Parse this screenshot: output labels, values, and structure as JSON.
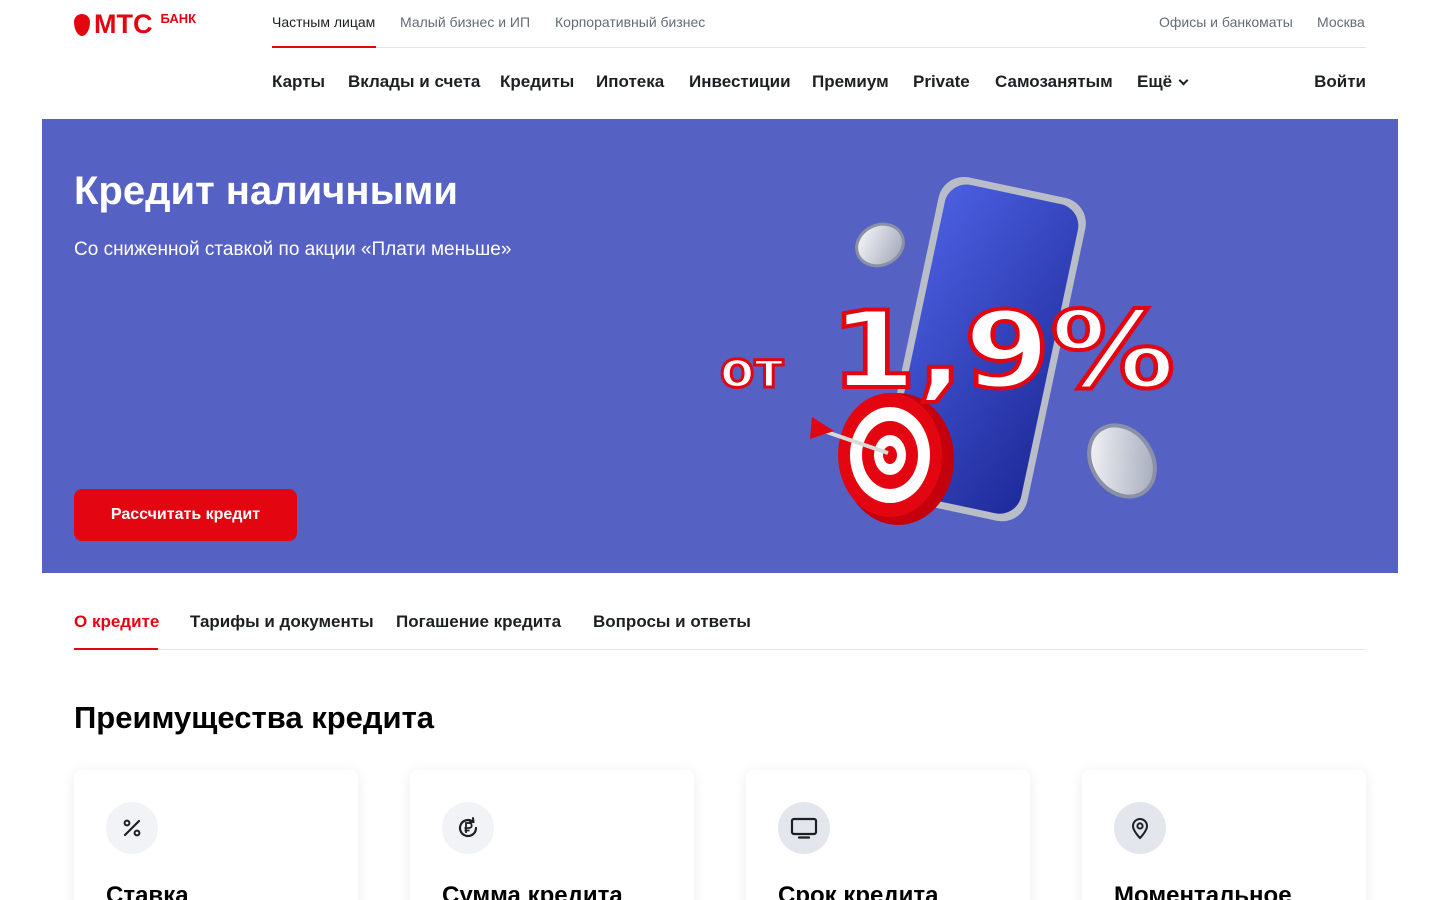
{
  "brand": {
    "logo_text": "МТС",
    "logo_sub": "БАНК",
    "color": "#e30611"
  },
  "topnav": {
    "segments": [
      "Частным лицам",
      "Малый бизнес и ИП",
      "Корпоративный бизнес"
    ],
    "offices": "Офисы и банкоматы",
    "city": "Москва"
  },
  "mainnav": {
    "items": [
      "Карты",
      "Вклады и счета",
      "Кредиты",
      "Ипотека",
      "Инвестиции",
      "Премиум",
      "Private",
      "Самозанятым",
      "Ещё"
    ],
    "login": "Войти"
  },
  "hero": {
    "title": "Кредит наличными",
    "subtitle": "Со сниженной ставкой по акции «Плати меньше»",
    "button": "Рассчитать кредит",
    "promo_prefix": "от",
    "promo_rate": "1,9%",
    "background": "#5661c4"
  },
  "tabs": {
    "items": [
      "О кредите",
      "Тарифы и документы",
      "Погашение кредита",
      "Вопросы и ответы"
    ],
    "active": "О кредите"
  },
  "advantages": {
    "title": "Преимущества кредита",
    "cards": [
      {
        "title": "Ставка",
        "icon": "percent-icon"
      },
      {
        "title": "Сумма кредита",
        "icon": "ruble-refresh-icon"
      },
      {
        "title": "Срок кредита",
        "icon": "monitor-icon"
      },
      {
        "title": "Моментальное",
        "icon": "location-pin-icon"
      }
    ]
  }
}
